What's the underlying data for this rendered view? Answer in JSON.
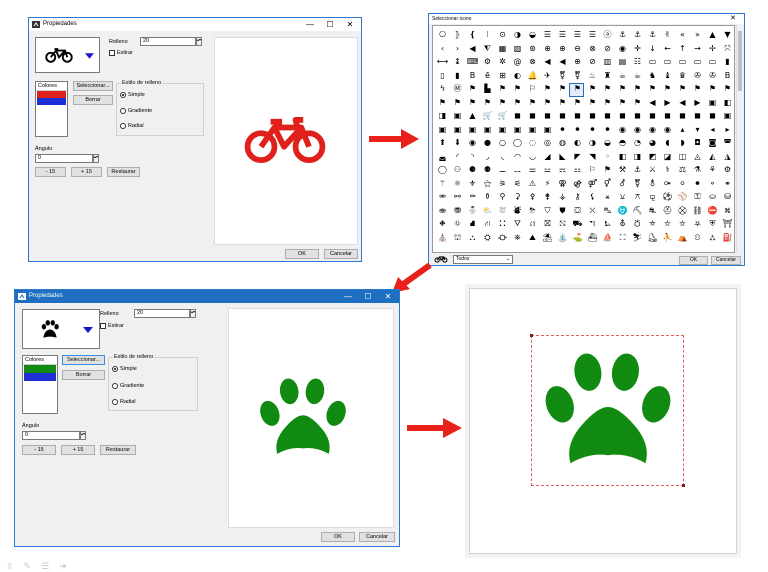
{
  "win1": {
    "title": "Propiedades",
    "fill_label": "Relleno",
    "fill_value": "20",
    "stretch_label": "Estirar",
    "colors_header": "Colores",
    "select_btn": "Seleccionar...",
    "clear_btn": "Borrar",
    "style_group": "Estilo de relleno",
    "opt_simple": "Simple",
    "opt_gradient": "Gradiente",
    "opt_radial": "Radial",
    "angle_label": "Ángulo",
    "angle_value": "0",
    "minus_btn": "- 15",
    "plus_btn": "+ 15",
    "reset_btn": "Restaurar",
    "ok_btn": "OK",
    "cancel_btn": "Cancelar",
    "icon_name": "bicycle-icon",
    "icon_color": "#e0201b",
    "swatches": [
      "#e0201b",
      "#1f2fd6"
    ]
  },
  "win2": {
    "title": "Seleccionar icono",
    "filter_value": "Todos",
    "ok_btn": "OK",
    "cancel_btn": "Cancelar",
    "glyphs": "⎔⦄❴⁝⊙◑◒☰☰☰☰ⓐ⚓⚓⚓✌«»▲▼‹›◀⧨▦▧⊛⊕⊕⊖⊗⊘◉✛↓←↑→✢⤧⟷↨⌨⚙✲@⊗◀◀⊕⊘▥▤☷▭▭▭▭▭▮▯▮Bē⊞◐🔔✈⚧⚧♨♜☕☕♞♝♛✇✇BϟⓂ⚑▙⚑⚑⚐⚑⚑⚑⚑⚑⚑⚑⚑⚑⚑⚑⚑⚑⚑⚑⚑⚑⚑⚑⚑⚑⚑⚑⚑⚑⚑⚑◀▶◀▶▣◧◨▣▲🛒🛒◼◼◼◼◼◼◼◼◼◼◼◼◼◼▣▣▣▣▣▣▣▣▣⚫⚫⚫⚫◉◉◉◉▴▾◂▸⬆⬇◉●○◯◌◎◍◐◑◒◓◔◕◖◗◘◙◚◛◜◝◞◟◠◡◢◣◤◥◦◧◨◩◪◫◬◭◮◯⚇⚈⚉⚊⚋⚌⚍⚎⚏⚐⚑⚒⚓⚔⚕⚖⚗⚘⚙⚚⚛⚜⚝⚞⚟⚠⚡⚢⚣⚤⚥⚦⚧⚨⚩⚪⚫⚬⚭⚮⚯⚰⚱⚲⚳⚴⚵⚶⚷⚸⚹⚺⚻⚼⚽⚾⚿⛀⛁⛂⛃⛄⛅⛆⛇⛈⛉⛊⛋⛌⛍⛎⛏⛐⛑⛒⛓⛔⛕⛖⛗⛘⛙⛚⛛⛜⛝⛞⛟⛠⛡⛢⛣⛤⛥⛦⛧⛨⛩⛪⛫⛬⛭⛮⛯⛰⛱⛲⛳⛴⛵⛶⛷⛸⛹⛺⛻⛼⛽⛾⛿"
  },
  "win3": {
    "title": "Propiedades",
    "fill_label": "Relleno",
    "fill_value": "20",
    "stretch_label": "Estirar",
    "colors_header": "Colores",
    "select_btn": "Seleccionar...",
    "clear_btn": "Borrar",
    "style_group": "Estilo de relleno",
    "opt_simple": "Simple",
    "opt_gradient": "Gradiente",
    "opt_radial": "Radial",
    "angle_label": "Ángulo",
    "angle_value": "0",
    "minus_btn": "- 15",
    "plus_btn": "+ 15",
    "reset_btn": "Restaurar",
    "ok_btn": "OK",
    "cancel_btn": "Cancelar",
    "icon_name": "paw-icon",
    "icon_color": "#118a11",
    "swatches": [
      "#118a11",
      "#1f2fd6"
    ]
  },
  "result": {
    "icon_name": "paw-icon",
    "icon_color": "#118a11",
    "selection_color": "#e06060"
  },
  "arrows": {
    "color": "#e8221b"
  }
}
